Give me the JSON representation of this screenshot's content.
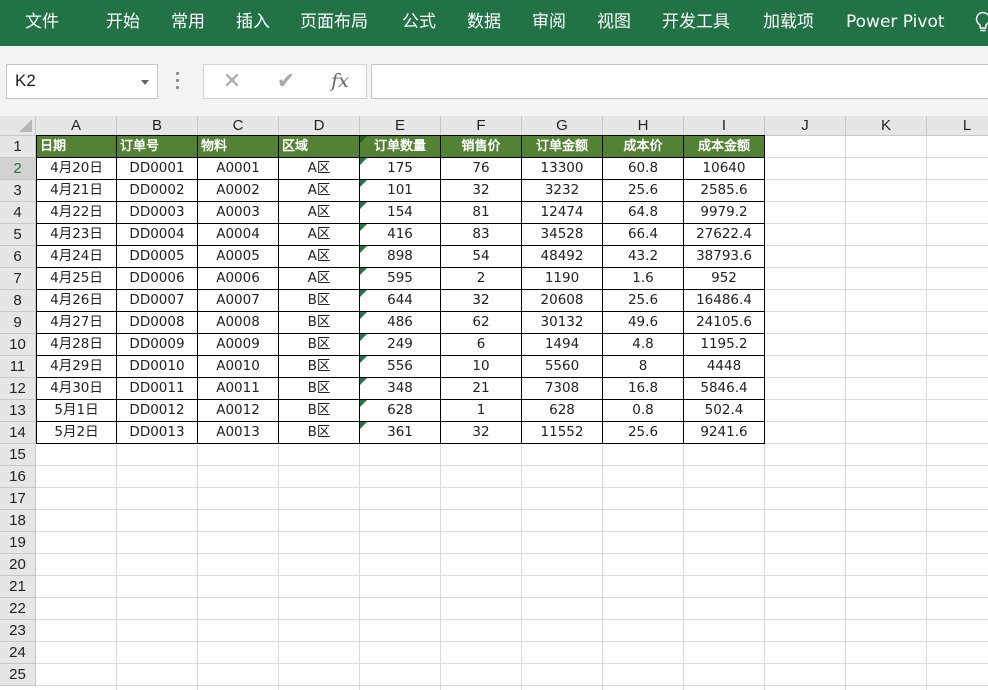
{
  "ribbon": {
    "tabs": [
      "文件",
      "开始",
      "常用",
      "插入",
      "页面布局",
      "公式",
      "数据",
      "审阅",
      "视图",
      "开发工具",
      "加载项",
      "Power Pivot"
    ],
    "help_icon": "lightbulb-icon",
    "color": "#217346"
  },
  "formula_bar": {
    "name_box": "K2",
    "cancel_icon": "✕",
    "enter_icon": "✔",
    "fx_label": "fx",
    "formula": ""
  },
  "sheet": {
    "column_letters": [
      "A",
      "B",
      "C",
      "D",
      "E",
      "F",
      "G",
      "H",
      "I",
      "J",
      "K",
      "L"
    ],
    "row_numbers": [
      "1",
      "2",
      "3",
      "4",
      "5",
      "6",
      "7",
      "8",
      "9",
      "10",
      "11",
      "12",
      "13",
      "14",
      "15",
      "16",
      "17",
      "18",
      "19",
      "20",
      "21",
      "22",
      "23",
      "24",
      "25"
    ],
    "selected_row": "2",
    "header_fill": "#548235",
    "headers": [
      "日期",
      "订单号",
      "物料",
      "区域",
      "订单数量",
      "销售价",
      "订单金额",
      "成本价",
      "成本金额"
    ],
    "rows": [
      [
        "4月20日",
        "DD0001",
        "A0001",
        "A区",
        "175",
        "76",
        "13300",
        "60.8",
        "10640"
      ],
      [
        "4月21日",
        "DD0002",
        "A0002",
        "A区",
        "101",
        "32",
        "3232",
        "25.6",
        "2585.6"
      ],
      [
        "4月22日",
        "DD0003",
        "A0003",
        "A区",
        "154",
        "81",
        "12474",
        "64.8",
        "9979.2"
      ],
      [
        "4月23日",
        "DD0004",
        "A0004",
        "A区",
        "416",
        "83",
        "34528",
        "66.4",
        "27622.4"
      ],
      [
        "4月24日",
        "DD0005",
        "A0005",
        "A区",
        "898",
        "54",
        "48492",
        "43.2",
        "38793.6"
      ],
      [
        "4月25日",
        "DD0006",
        "A0006",
        "A区",
        "595",
        "2",
        "1190",
        "1.6",
        "952"
      ],
      [
        "4月26日",
        "DD0007",
        "A0007",
        "B区",
        "644",
        "32",
        "20608",
        "25.6",
        "16486.4"
      ],
      [
        "4月27日",
        "DD0008",
        "A0008",
        "B区",
        "486",
        "62",
        "30132",
        "49.6",
        "24105.6"
      ],
      [
        "4月28日",
        "DD0009",
        "A0009",
        "B区",
        "249",
        "6",
        "1494",
        "4.8",
        "1195.2"
      ],
      [
        "4月29日",
        "DD0010",
        "A0010",
        "B区",
        "556",
        "10",
        "5560",
        "8",
        "4448"
      ],
      [
        "4月30日",
        "DD0011",
        "A0011",
        "B区",
        "348",
        "21",
        "7308",
        "16.8",
        "5846.4"
      ],
      [
        "5月1日",
        "DD0012",
        "A0012",
        "B区",
        "628",
        "1",
        "628",
        "0.8",
        "502.4"
      ],
      [
        "5月2日",
        "DD0013",
        "A0013",
        "B区",
        "361",
        "32",
        "11552",
        "25.6",
        "9241.6"
      ]
    ]
  }
}
